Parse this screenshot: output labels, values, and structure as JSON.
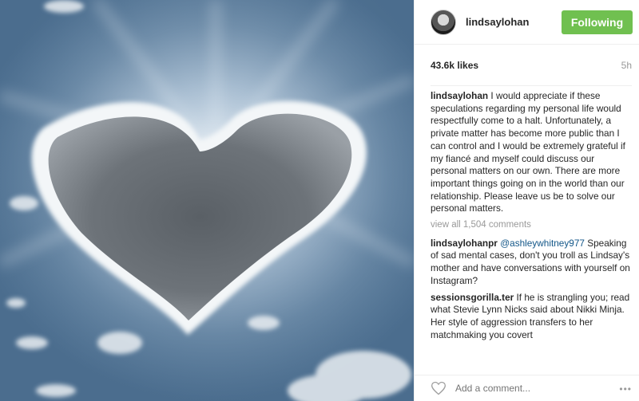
{
  "post": {
    "username": "lindsaylohan",
    "follow_label": "Following",
    "likes": "43.6k likes",
    "time": "5h",
    "caption": {
      "author": "lindsaylohan",
      "text": "I would appreciate if these speculations regarding my personal life would respectfully come to a halt. Unfortunately, a private matter has become more public than I can control and I would be extremely grateful if my fiancé and myself could discuss our personal matters on our own. There are more important things going on in the world than our relationship. Please leave us be to solve our personal matters."
    },
    "view_all_comments": "view all 1,504 comments",
    "comments": [
      {
        "author": "lindsaylohanpr",
        "mention": "@ashleywhitney977",
        "text": "Speaking of sad mental cases, don't you troll as Lindsay's mother and have conversations with yourself on Instagram?"
      },
      {
        "author": "sessionsgorilla.ter",
        "mention": "",
        "text": "If he is strangling you; read what Stevie Lynn Nicks said about Nikki Minja. Her style of aggression transfers to her matchmaking you covert"
      }
    ],
    "add_comment_placeholder": "Add a comment...",
    "more_label": "•••"
  },
  "colors": {
    "follow_button": "#70c050",
    "mention": "#125688"
  },
  "icons": {
    "like": "heart-outline-icon",
    "more": "more-options-icon",
    "avatar": "avatar"
  }
}
